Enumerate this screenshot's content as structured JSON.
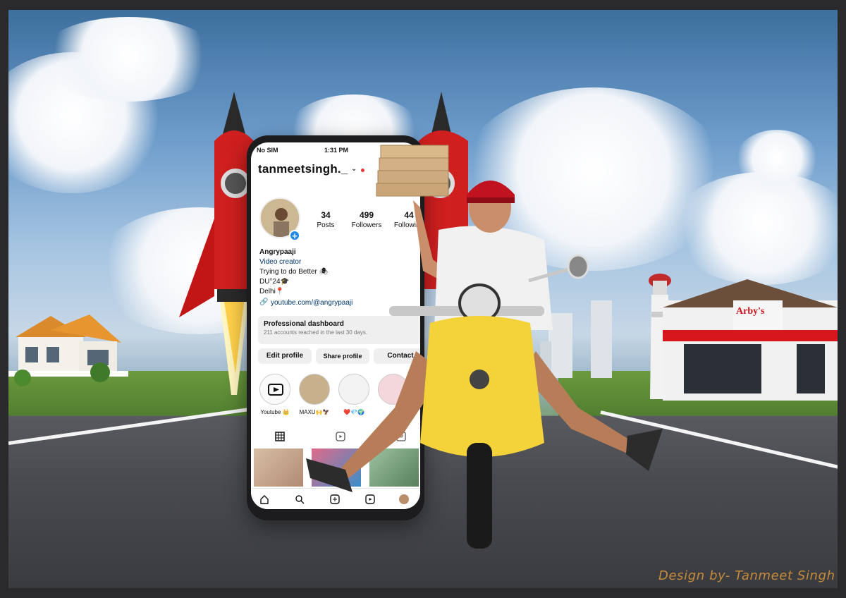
{
  "phone": {
    "status_left": "No SIM",
    "status_time": "1:31 PM",
    "username": "tanmeetsingh._",
    "stats": [
      {
        "number": "34",
        "label": "Posts"
      },
      {
        "number": "499",
        "label": "Followers"
      },
      {
        "number": "44",
        "label": "Following"
      }
    ],
    "bio": {
      "name": "Angrypaaji",
      "category": "Video creator",
      "line1": "Trying to do Better 🕷",
      "line2": "DU°24🎓",
      "line3": "Delhi📍",
      "link": "youtube.com/@angrypaaji"
    },
    "dashboard": {
      "title": "Professional dashboard",
      "subtitle": "211 accounts reached in the last 30 days."
    },
    "buttons": {
      "edit": "Edit profile",
      "share": "Share profile",
      "contact": "Contact"
    },
    "highlights": [
      {
        "label": "Youtube 👑"
      },
      {
        "label": "MAXU🙌🦅"
      },
      {
        "label": "❤️💎🌍"
      },
      {
        "label": ""
      }
    ]
  },
  "store_sign": "Arby's",
  "credit": "Design by- Tanmeet Singh",
  "colors": {
    "accent_blue": "#1e88e5",
    "link_blue": "#00376b",
    "scooter_yellow": "#f3d23a",
    "helmet_red": "#c1121f",
    "rocket_red": "#d01f1f",
    "credit_orange": "#c58a3d"
  }
}
